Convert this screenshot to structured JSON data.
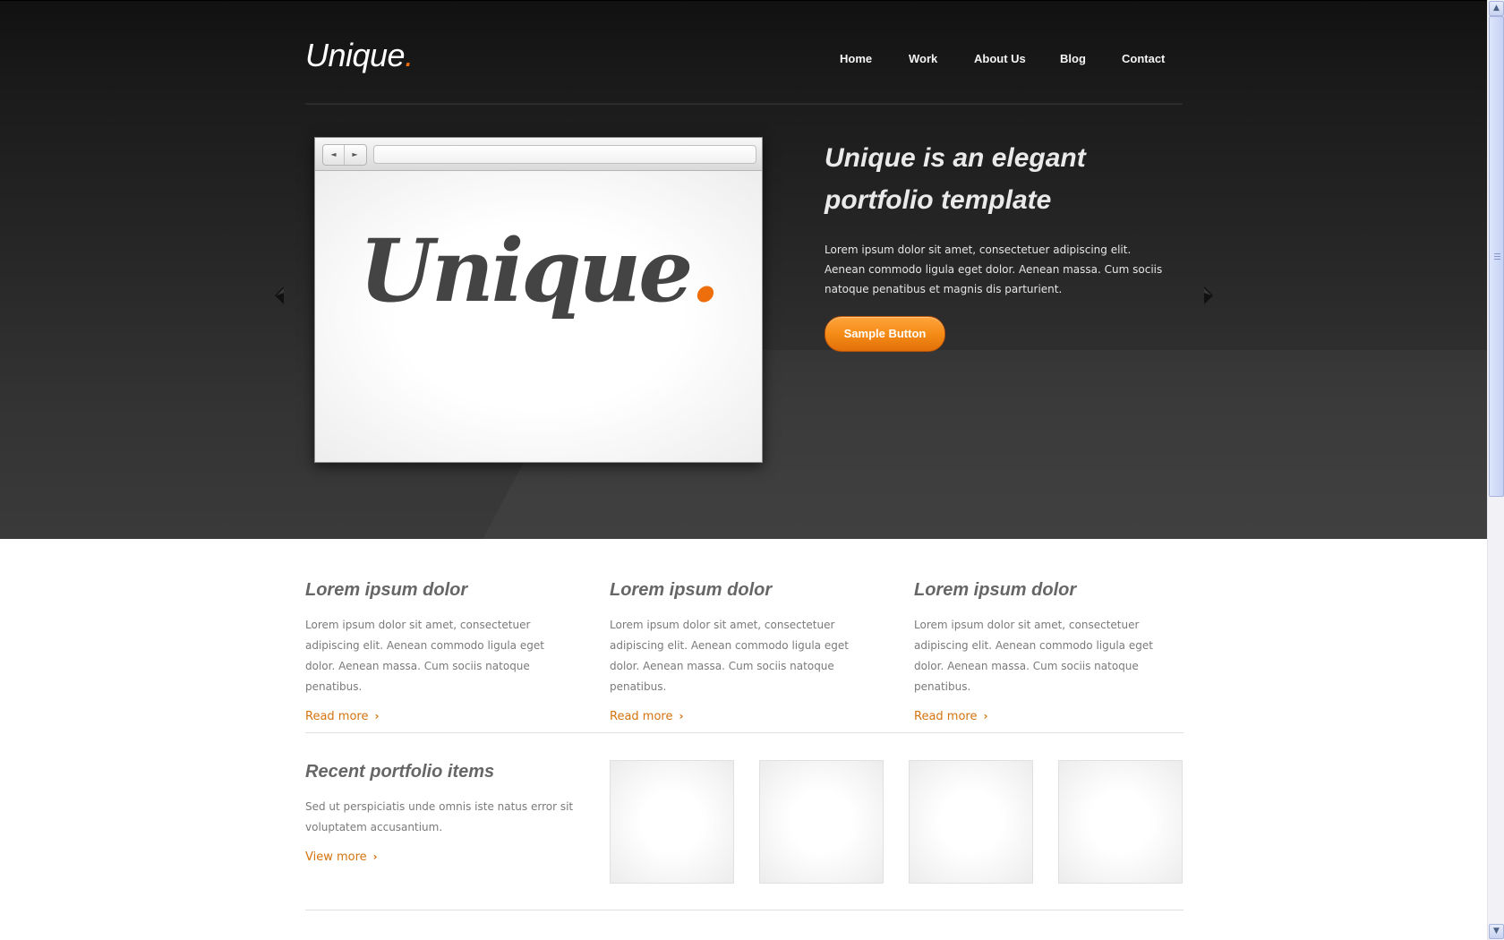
{
  "header": {
    "logo": "Unique",
    "logo_dot": ".",
    "nav": [
      "Home",
      "Work",
      "About Us",
      "Blog",
      "Contact"
    ]
  },
  "slider": {
    "browser_logo": "Unique",
    "browser_logo_dot": ".",
    "back_glyph": "◄",
    "forward_glyph": "►",
    "heading": "Unique is an elegant portfolio template",
    "text": "Lorem ipsum dolor sit amet, consectetuer adipiscing elit. Aenean commodo ligula eget dolor. Aenean massa. Cum sociis natoque penatibus et magnis dis parturient.",
    "button": "Sample Button"
  },
  "features": [
    {
      "heading": "Lorem ipsum dolor",
      "text": "Lorem ipsum dolor sit amet, consectetuer adipiscing elit. Aenean commodo ligula eget dolor. Aenean massa. Cum sociis natoque penatibus.",
      "link": "Read more"
    },
    {
      "heading": "Lorem ipsum dolor",
      "text": "Lorem ipsum dolor sit amet, consectetuer adipiscing elit. Aenean commodo ligula eget dolor. Aenean massa. Cum sociis natoque penatibus.",
      "link": "Read more"
    },
    {
      "heading": "Lorem ipsum dolor",
      "text": "Lorem ipsum dolor sit amet, consectetuer adipiscing elit. Aenean commodo ligula eget dolor. Aenean massa. Cum sociis natoque penatibus.",
      "link": "Read more"
    }
  ],
  "portfolio": {
    "heading": "Recent portfolio items",
    "text": "Sed ut perspiciatis unde omnis iste natus error sit voluptatem accusantium.",
    "link": "View more",
    "thumbnail_count": 4
  },
  "chevron": "›",
  "scrollbar": {
    "up_glyph": "▲",
    "down_glyph": "▼"
  },
  "colors": {
    "accent": "#ee6e0c",
    "link": "#d4730e",
    "hero_bg": "#262626",
    "heading": "#666666",
    "body_text": "#7a7a7a"
  }
}
